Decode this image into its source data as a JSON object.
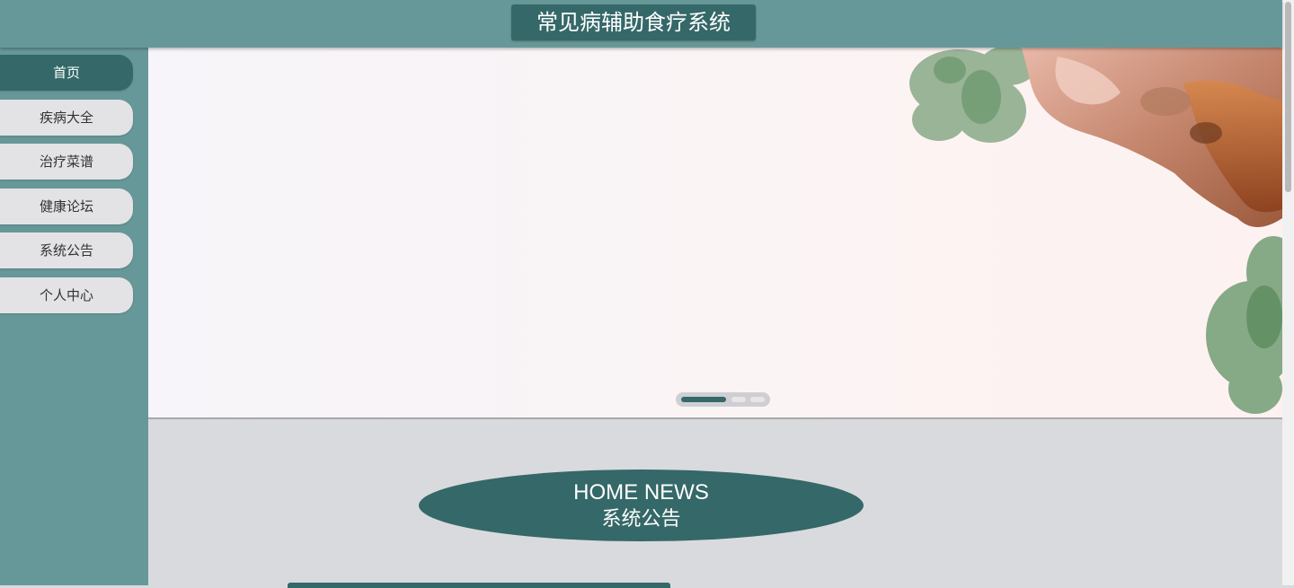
{
  "header": {
    "title": "常见病辅助食疗系统"
  },
  "sidebar": {
    "items": [
      {
        "label": "首页",
        "active": true
      },
      {
        "label": "疾病大全",
        "active": false
      },
      {
        "label": "治疗菜谱",
        "active": false
      },
      {
        "label": "健康论坛",
        "active": false
      },
      {
        "label": "系统公告",
        "active": false
      },
      {
        "label": "个人中心",
        "active": false
      }
    ]
  },
  "banner": {
    "image": "food-plate-with-meat-and-greens",
    "slides": 3,
    "current_slide": 1
  },
  "news": {
    "heading_en": "HOME NEWS",
    "heading_cn": "系统公告"
  },
  "colors": {
    "primary": "#356868",
    "sidebar_bg": "#679899",
    "nav_bg": "#e3e3e6",
    "content_bg": "#d9dadd"
  }
}
